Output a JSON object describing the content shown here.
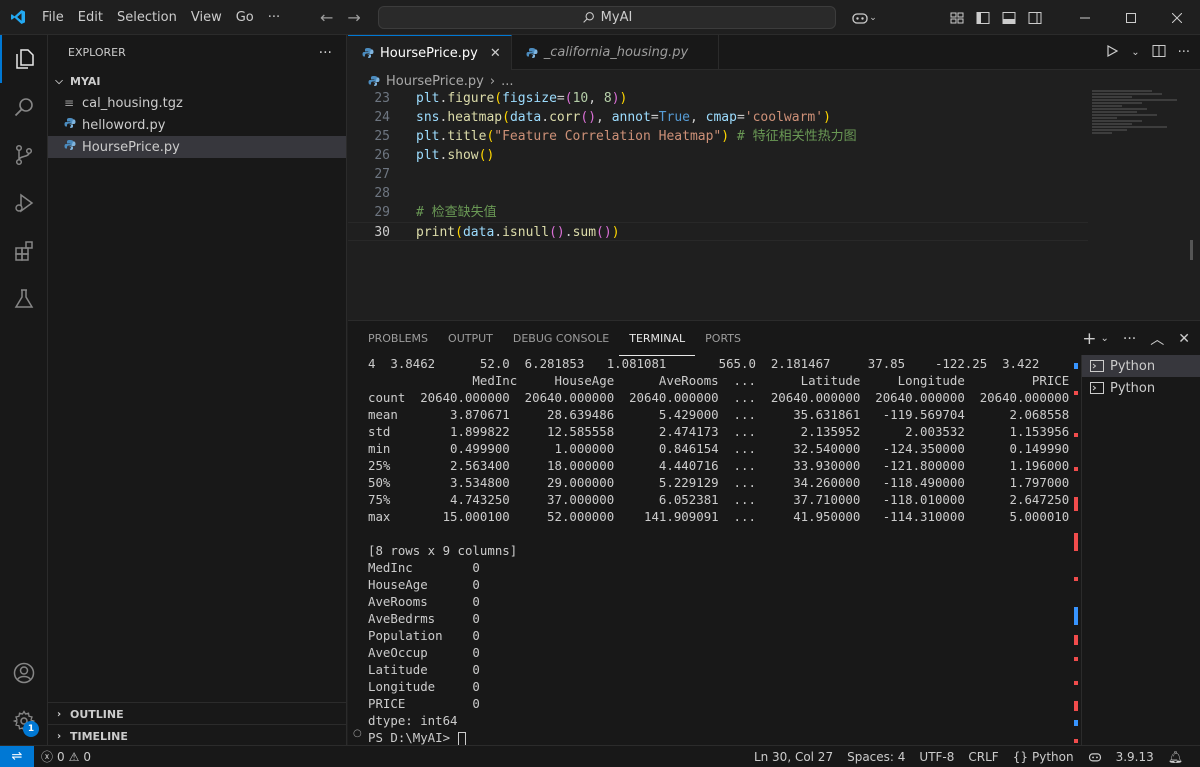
{
  "menu": [
    "File",
    "Edit",
    "Selection",
    "View",
    "Go",
    "···"
  ],
  "search": {
    "text": "MyAI"
  },
  "explorer": {
    "title": "EXPLORER",
    "folder": "MYAI",
    "files": [
      "cal_housing.tgz",
      "helloword.py",
      "HoursePrice.py"
    ],
    "outline": "OUTLINE",
    "timeline": "TIMELINE"
  },
  "tabs": [
    "HoursePrice.py",
    "_california_housing.py"
  ],
  "breadcrumb": {
    "file": "HoursePrice.py",
    "more": "..."
  },
  "code": {
    "line_numbers": [
      "23",
      "24",
      "25",
      "26",
      "27",
      "28",
      "29",
      "30"
    ]
  },
  "panel": {
    "tabs": [
      "PROBLEMS",
      "OUTPUT",
      "DEBUG CONSOLE",
      "TERMINAL",
      "PORTS"
    ],
    "terminal_lines": [
      "4  3.8462      52.0  6.281853   1.081081       565.0  2.181467     37.85    -122.25  3.422",
      "              MedInc     HouseAge      AveRooms  ...      Latitude     Longitude         PRICE",
      "count  20640.000000  20640.000000  20640.000000  ...  20640.000000  20640.000000  20640.000000",
      "mean       3.870671     28.639486      5.429000  ...     35.631861   -119.569704      2.068558",
      "std        1.899822     12.585558      2.474173  ...      2.135952      2.003532      1.153956",
      "min        0.499900      1.000000      0.846154  ...     32.540000   -124.350000      0.149990",
      "25%        2.563400     18.000000      4.440716  ...     33.930000   -121.800000      1.196000",
      "50%        3.534800     29.000000      5.229129  ...     34.260000   -118.490000      1.797000",
      "75%        4.743250     37.000000      6.052381  ...     37.710000   -118.010000      2.647250",
      "max       15.000100     52.000000    141.909091  ...     41.950000   -114.310000      5.000010",
      "",
      "[8 rows x 9 columns]",
      "MedInc        0",
      "HouseAge      0",
      "AveRooms      0",
      "AveBedrms     0",
      "Population    0",
      "AveOccup      0",
      "Latitude      0",
      "Longitude     0",
      "PRICE         0",
      "dtype: int64",
      "PS D:\\MyAI> "
    ],
    "terminals": [
      "Python",
      "Python"
    ]
  },
  "status": {
    "errors": "0",
    "warnings": "0",
    "position": "Ln 30, Col 27",
    "spaces": "Spaces: 4",
    "encoding": "UTF-8",
    "eol": "CRLF",
    "language": "Python",
    "version": "3.9.13",
    "settings_badge": "1"
  },
  "icons": {
    "vscode": "vscode-logo-icon",
    "explorer": "files-icon",
    "search": "search-icon",
    "scm": "source-control-icon",
    "debug": "run-debug-icon",
    "extensions": "extensions-icon",
    "testing": "flask-icon",
    "account": "account-icon",
    "manage": "gear-icon"
  },
  "colors": {
    "accent": "#0078d4",
    "background": "#1f1f1f",
    "sidebar": "#181818"
  }
}
